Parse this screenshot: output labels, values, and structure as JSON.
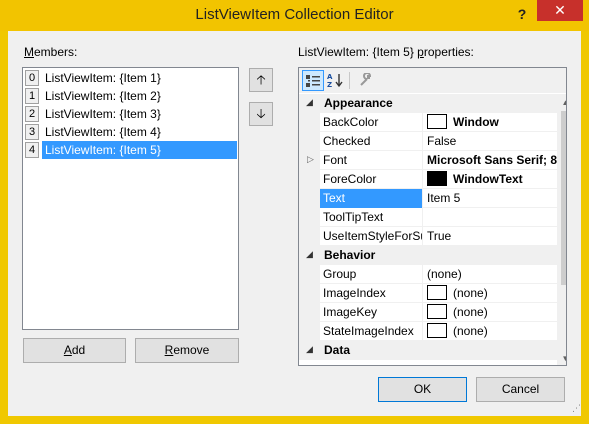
{
  "window": {
    "title": "ListViewItem Collection Editor",
    "help_label": "?",
    "close_label": "✕"
  },
  "members": {
    "label_mnemonic": "M",
    "label_rest": "embers:",
    "items": [
      {
        "index": "0",
        "text": "ListViewItem: {Item 1}"
      },
      {
        "index": "1",
        "text": "ListViewItem: {Item 2}"
      },
      {
        "index": "2",
        "text": "ListViewItem: {Item 3}"
      },
      {
        "index": "3",
        "text": "ListViewItem: {Item 4}"
      },
      {
        "index": "4",
        "text": "ListViewItem: {Item 5}",
        "selected": true
      }
    ],
    "move_up_icon": "arrow-up-icon",
    "move_down_icon": "arrow-down-icon",
    "add_mnemonic": "A",
    "add_rest": "dd",
    "remove_mnemonic": "R",
    "remove_rest": "emove"
  },
  "properties": {
    "label_start": "ListViewItem: {Item 5} ",
    "label_mnemonic": "p",
    "label_rest": "roperties:",
    "toolbar": {
      "categorized_icon": "categorized-icon",
      "alphabetical_icon": "alphabetical-icon",
      "property_pages_icon": "wrench-icon"
    },
    "categories": [
      {
        "name": "Appearance",
        "rows": [
          {
            "name": "BackColor",
            "value": "Window",
            "swatch": "#ffffff",
            "bold": true
          },
          {
            "name": "Checked",
            "value": "False"
          },
          {
            "name": "Font",
            "value": "Microsoft Sans Serif; 8",
            "bold": true,
            "expandable": true
          },
          {
            "name": "ForeColor",
            "value": "WindowText",
            "swatch": "#000000",
            "bold": true
          },
          {
            "name": "Text",
            "value": "Item 5",
            "selected": true
          },
          {
            "name": "ToolTipText",
            "value": ""
          },
          {
            "name": "UseItemStyleForSu",
            "value": "True"
          }
        ]
      },
      {
        "name": "Behavior",
        "rows": [
          {
            "name": "Group",
            "value": "(none)"
          },
          {
            "name": "ImageIndex",
            "value": "(none)",
            "swatch": "#ffffff"
          },
          {
            "name": "ImageKey",
            "value": "(none)",
            "swatch": "#ffffff"
          },
          {
            "name": "StateImageIndex",
            "value": "(none)",
            "swatch": "#ffffff"
          }
        ]
      },
      {
        "name": "Data",
        "rows": []
      }
    ]
  },
  "footer": {
    "ok_label": "OK",
    "cancel_label": "Cancel"
  },
  "colors": {
    "accent_border": "#f0c800",
    "close_red": "#c7302b",
    "selection_blue": "#3399ff"
  }
}
